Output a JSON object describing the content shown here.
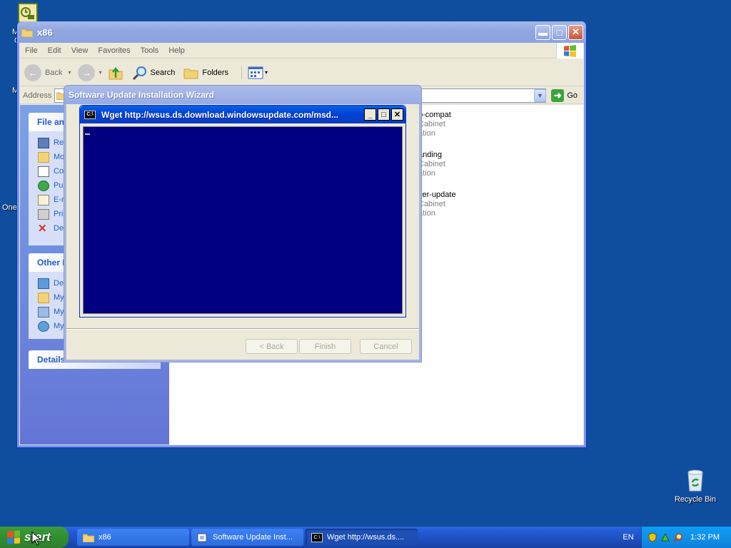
{
  "desktop": {
    "icon_top_partial_1": "M",
    "icon_top_partial_2": "C",
    "icon_mid_partial": "M",
    "icon_one_partial": "One",
    "recycle_bin_label": "Recycle Bin"
  },
  "explorer": {
    "title": "x86",
    "menu": [
      "File",
      "Edit",
      "View",
      "Favorites",
      "Tools",
      "Help"
    ],
    "toolbar": {
      "back": "Back",
      "search": "Search",
      "folders": "Folders"
    },
    "address_label": "Address",
    "go_label": "Go",
    "file_tasks": {
      "header": "File an",
      "items": [
        "Re",
        "Mo",
        "Co",
        "Pul",
        "E-r",
        "Prin",
        "De"
      ]
    },
    "other_places": {
      "header": "Other I",
      "items": [
        "De",
        "My",
        "My",
        "My"
      ]
    },
    "details": {
      "header": "Details"
    },
    "files": [
      {
        "name": "p-compat",
        "type": "Cabinet",
        "desc": "ation"
      },
      {
        "name": "anding",
        "type": "Cabinet",
        "desc": "ation"
      },
      {
        "name": "ver-update",
        "type": "Cabinet",
        "desc": "ation"
      }
    ]
  },
  "wizard": {
    "title": "Software Update Installation Wizard",
    "buttons": {
      "back": "< Back",
      "finish": "Finish",
      "cancel": "Cancel"
    }
  },
  "console": {
    "title": "Wget http://wsus.ds.download.windowsupdate.com/msd...",
    "icon_text": "C:\\"
  },
  "taskbar": {
    "start": "start",
    "tasks": [
      {
        "label": "x86"
      },
      {
        "label": "Software Update Inst..."
      },
      {
        "label": "Wget http://wsus.ds...."
      }
    ],
    "language": "EN",
    "clock": "1:32 PM"
  },
  "colors": {
    "desktop": "#0f4d9e",
    "console_bg": "#000080",
    "taskbar": "#245edb",
    "start_button": "#2f8f2f",
    "tray": "#1290e8"
  }
}
